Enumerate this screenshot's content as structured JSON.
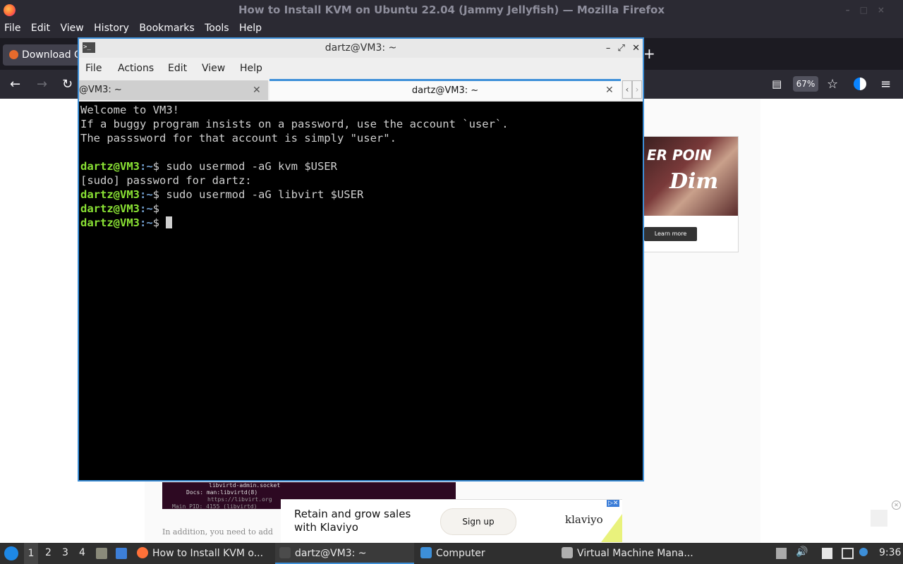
{
  "firefox": {
    "window_title": "How to Install KVM on Ubuntu 22.04 (Jammy Jellyfish) — Mozilla Firefox",
    "menu": [
      "File",
      "Edit",
      "View",
      "History",
      "Bookmarks",
      "Tools",
      "Help"
    ],
    "tab_label": "Download Q",
    "new_tab": "+",
    "zoom": "67%",
    "right_ad": {
      "headline": "ER POIN",
      "sub": "Dim",
      "button": "Learn more"
    },
    "snippet_lines": [
      "libvirtd-admin.socket",
      "Docs: man:libvirtd(8)",
      "https://libvirt.org",
      "Main PID: 4155 (libvirtd)"
    ],
    "page_text": "In addition, you need to add",
    "bottom_ad": {
      "line1": "Retain and grow sales",
      "line2": "with Klaviyo",
      "button": "Sign up",
      "brand": "klaviyo"
    }
  },
  "terminal": {
    "window_title": "dartz@VM3: ~",
    "menu": [
      "File",
      "Actions",
      "Edit",
      "View",
      "Help"
    ],
    "tabs": [
      {
        "label": "@VM3: ~"
      },
      {
        "label": "dartz@VM3: ~"
      }
    ],
    "motd": [
      "Welcome to VM3!",
      "If a buggy program insists on a password, use the account `user`.",
      "The passsword for that account is simply \"user\"."
    ],
    "prompt_user": "dartz@VM3",
    "prompt_path": ":~",
    "prompt_sym": "$",
    "cmd1": " sudo usermod -aG kvm $USER",
    "sudo_prompt": "[sudo] password for dartz:",
    "cmd2": " sudo usermod -aG libvirt $USER"
  },
  "taskbar": {
    "workspaces": [
      "1",
      "2",
      "3",
      "4"
    ],
    "tasks": [
      {
        "label": "How to Install KVM o..."
      },
      {
        "label": "dartz@VM3: ~"
      },
      {
        "label": "Computer"
      },
      {
        "label": "Virtual Machine Mana..."
      }
    ],
    "clock": "9:36"
  }
}
